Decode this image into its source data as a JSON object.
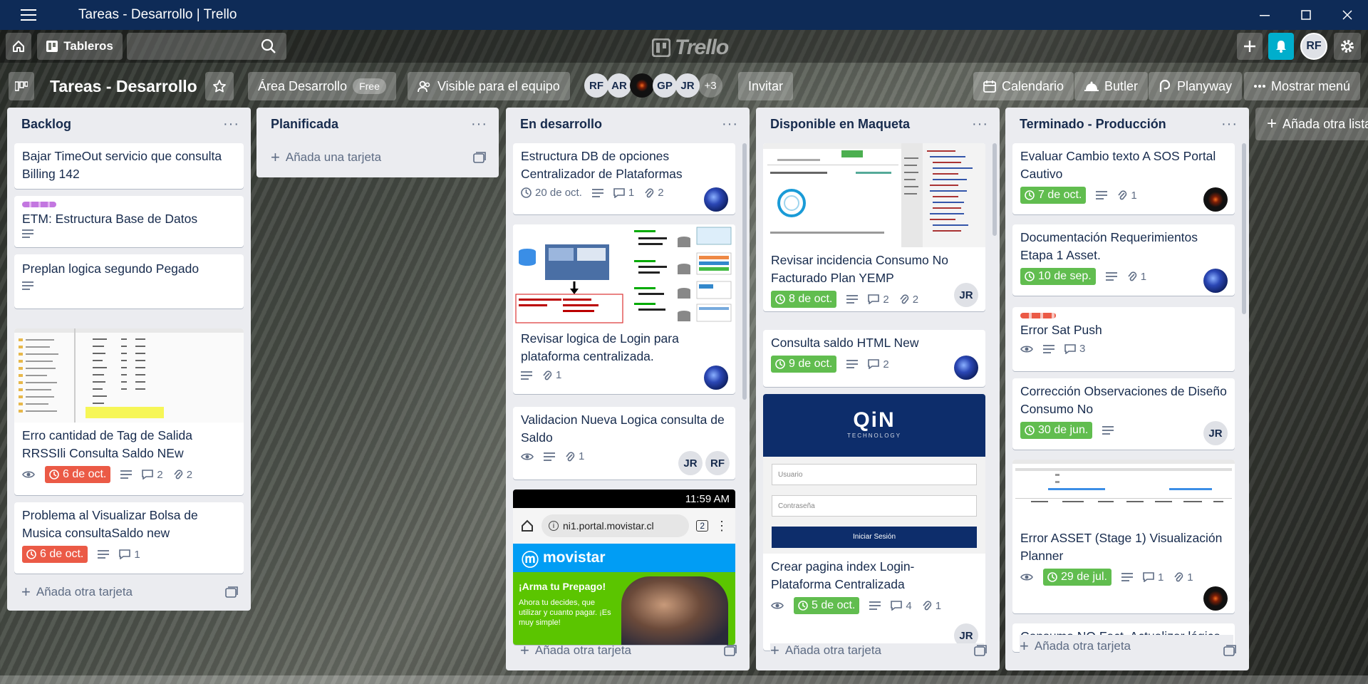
{
  "window": {
    "title": "Tareas - Desarrollo | Trello"
  },
  "header": {
    "boards_label": "Tableros",
    "search_placeholder": "",
    "logo": "Trello",
    "user_initials": "RF"
  },
  "board": {
    "name": "Tareas - Desarrollo",
    "workspace": "Área Desarrollo",
    "plan": "Free",
    "visibility": "Visible para el equipo",
    "members": [
      "RF",
      "AR",
      "",
      "GP",
      "JR"
    ],
    "more_members": "+3",
    "invite": "Invitar",
    "calendar": "Calendario",
    "butler": "Butler",
    "planyway": "Planyway",
    "menu": "Mostrar menú"
  },
  "lists": [
    {
      "title": "Backlog",
      "add": "Añada otra tarjeta",
      "cards": [
        {
          "title": "Bajar TimeOut servicio que consulta Billing 142"
        },
        {
          "title": "ETM: Estructura Base de Datos"
        },
        {
          "title": "Preplan logica segundo Pegado"
        },
        {
          "title": "Erro cantidad de Tag de Salida RRSSIli Consulta Saldo NEw",
          "due": "6 de oct.",
          "comments": "2",
          "attachments": "2"
        },
        {
          "title": "Problema al Visualizar Bolsa de Musica consultaSaldo new",
          "due": "6 de oct.",
          "comments": "1"
        }
      ]
    },
    {
      "title": "Planificada",
      "add": "Añada una tarjeta",
      "cards": []
    },
    {
      "title": "En desarrollo",
      "add": "Añada otra tarjeta",
      "cards": [
        {
          "title": "Estructura DB de opciones Centralizador de Plataformas",
          "due": "20 de oct.",
          "comments": "1",
          "attachments": "2"
        },
        {
          "title": "Revisar logica de Login para plataforma centralizada.",
          "attachments": "1"
        },
        {
          "title": "Validacion Nueva Logica consulta de Saldo",
          "attachments": "1",
          "members": [
            "JR",
            "RF"
          ]
        },
        {
          "cover_time": "11:59 AM",
          "cover_url": "ni1.portal.movistar.cl",
          "cover_tabs": "2",
          "cover_brand": "movistar",
          "cover_promo": "¡Arma tu Prepago!",
          "cover_sub": "Ahora tu decides, que utilizar y cuanto pagar. ¡Es muy simple!"
        }
      ]
    },
    {
      "title": "Disponible en Maqueta",
      "add": "Añada otra tarjeta",
      "cards": [
        {
          "title": "Revisar incidencia Consumo No Facturado Plan YEMP",
          "due": "8 de oct.",
          "comments": "2",
          "attachments": "2",
          "member": "JR"
        },
        {
          "title": "Consulta saldo HTML New",
          "due": "9 de oct.",
          "comments": "2"
        },
        {
          "title": "Crear pagina index Login- Plataforma Centralizada",
          "due": "5 de oct.",
          "comments": "4",
          "attachments": "1",
          "member": "JR",
          "cover_logo": "QiN",
          "cover_logo_sub": "TECHNOLOGY",
          "cover_user": "Usuario",
          "cover_pass": "Contraseña",
          "cover_btn": "Iniciar Sesión"
        }
      ]
    },
    {
      "title": "Terminado - Producción",
      "add": "Añada otra tarjeta",
      "cards": [
        {
          "title": "Evaluar Cambio texto A SOS Portal Cautivo",
          "due": "7 de oct.",
          "attachments": "1"
        },
        {
          "title": "Documentación Requerimientos Etapa 1 Asset.",
          "due": "10 de sep.",
          "attachments": "1"
        },
        {
          "title": "Error Sat Push",
          "comments": "3"
        },
        {
          "title": "Corrección Observaciones de Diseño Consumo No",
          "due": "30 de jun.",
          "member": "JR"
        },
        {
          "title": "Error ASSET (Stage 1) Visualización Planner",
          "due": "29 de jul.",
          "comments": "1",
          "attachments": "1"
        },
        {
          "title": "Consumo NO Fact. Actualizar lógica"
        }
      ]
    }
  ],
  "add_list": "Añada otra lista",
  "colors": {
    "titlebar": "#0e2b57",
    "due_green": "#61bd4f",
    "due_red": "#eb5a46",
    "bell": "#00aecc",
    "label_purple": "#c377e0",
    "label_red": "#eb5a46"
  }
}
